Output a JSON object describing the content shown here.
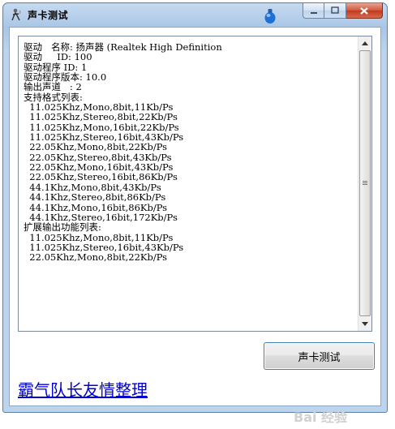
{
  "window": {
    "title": "声卡测试"
  },
  "listbox": {
    "lines": [
      "驱动   名称: 扬声器 (Realtek High Definition",
      "驱动     ID: 100",
      "驱动程序 ID: 1",
      "驱动程序版本: 10.0",
      "输出声道   : 2",
      "支持格式列表:",
      "  11.025Khz,Mono,8bit,11Kb/Ps",
      "  11.025Khz,Stereo,8bit,22Kb/Ps",
      "  11.025Khz,Mono,16bit,22Kb/Ps",
      "  11.025Khz,Stereo,16bit,43Kb/Ps",
      "  22.05Khz,Mono,8bit,22Kb/Ps",
      "  22.05Khz,Stereo,8bit,43Kb/Ps",
      "  22.05Khz,Mono,16bit,43Kb/Ps",
      "  22.05Khz,Stereo,16bit,86Kb/Ps",
      "  44.1Khz,Mono,8bit,43Kb/Ps",
      "  44.1Khz,Stereo,8bit,86Kb/Ps",
      "  44.1Khz,Mono,16bit,86Kb/Ps",
      "  44.1Khz,Stereo,16bit,172Kb/Ps",
      "扩展输出功能列表:",
      "  11.025Khz,Mono,8bit,11Kb/Ps",
      "  11.025Khz,Stereo,16bit,43Kb/Ps",
      "  22.05Khz,Mono,8bit,22Kb/Ps"
    ]
  },
  "buttons": {
    "test_label": "声卡测试"
  },
  "credit": {
    "text": "霸气队长友情整理"
  },
  "watermark": {
    "text": "Bai  经验"
  },
  "icons": {
    "app": "speaker-person-icon",
    "orb": "blue-orb-icon"
  },
  "colors": {
    "link": "#0000cc",
    "close_button": "#c0391d"
  }
}
